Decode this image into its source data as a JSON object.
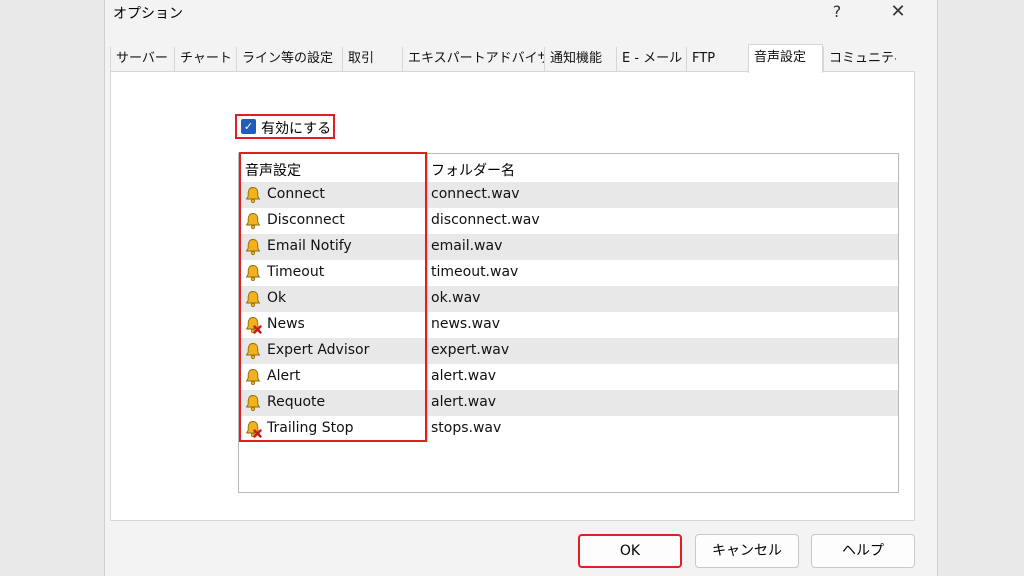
{
  "window": {
    "title": "オプション",
    "help_label": "?",
    "close_label": "✕"
  },
  "tabs": [
    {
      "label": "サーバー"
    },
    {
      "label": "チャート"
    },
    {
      "label": "ライン等の設定"
    },
    {
      "label": "取引"
    },
    {
      "label": "エキスパートアドバイザ"
    },
    {
      "label": "通知機能"
    },
    {
      "label": "E - メール"
    },
    {
      "label": "FTP"
    },
    {
      "label": "音声設定",
      "active": true
    },
    {
      "label": "コミュニティ"
    }
  ],
  "sound": {
    "enable_label": "有効にする",
    "enabled": true,
    "columns": [
      "音声設定",
      "フォルダー名"
    ],
    "rows": [
      {
        "event": "Connect",
        "file": "connect.wav",
        "icon": "bell-icon"
      },
      {
        "event": "Disconnect",
        "file": "disconnect.wav",
        "icon": "bell-icon"
      },
      {
        "event": "Email Notify",
        "file": "email.wav",
        "icon": "bell-icon"
      },
      {
        "event": "Timeout",
        "file": "timeout.wav",
        "icon": "bell-icon"
      },
      {
        "event": "Ok",
        "file": "ok.wav",
        "icon": "bell-icon"
      },
      {
        "event": "News",
        "file": "news.wav",
        "icon": "bell-disabled-icon"
      },
      {
        "event": "Expert Advisor",
        "file": "expert.wav",
        "icon": "bell-icon"
      },
      {
        "event": "Alert",
        "file": "alert.wav",
        "icon": "bell-icon"
      },
      {
        "event": "Requote",
        "file": "alert.wav",
        "icon": "bell-icon"
      },
      {
        "event": "Trailing Stop",
        "file": "stops.wav",
        "icon": "bell-disabled-icon"
      }
    ]
  },
  "buttons": {
    "ok": "OK",
    "cancel": "キャンセル",
    "help": "ヘルプ"
  },
  "colors": {
    "highlight": "#e02020",
    "checkbox": "#1e5db8",
    "bell": "#f2b21c"
  }
}
